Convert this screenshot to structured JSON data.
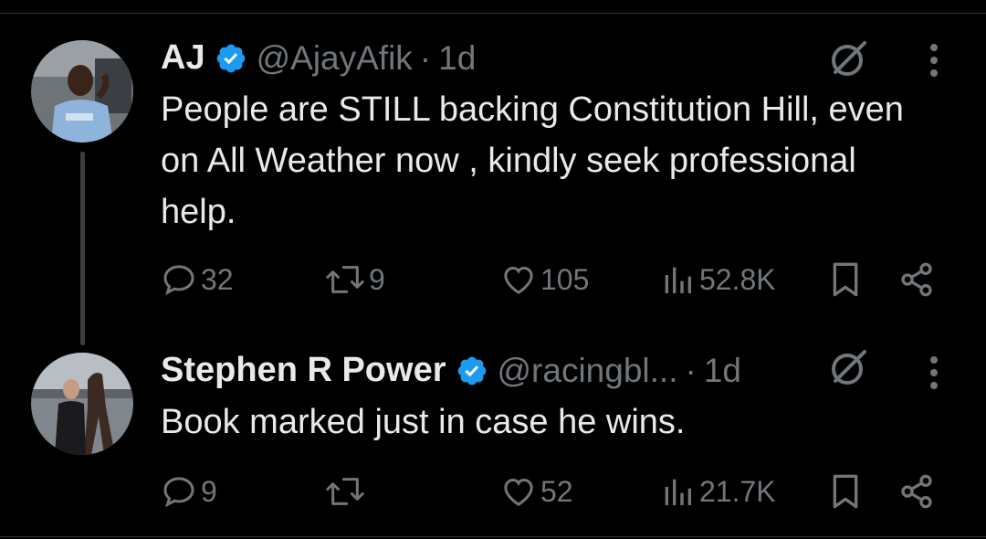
{
  "tweets": [
    {
      "name": "AJ",
      "handle": "@AjayAfik",
      "dot": "·",
      "time": "1d",
      "text": "People are STILL backing Constitution Hill, even on All Weather now , kindly seek professional help.",
      "replies": "32",
      "retweets": "9",
      "likes": "105",
      "views": "52.8K"
    },
    {
      "name": "Stephen R Power",
      "handle": "@racingbl...",
      "dot": "·",
      "time": "1d",
      "text": "Book marked just in case he wins.",
      "replies": "9",
      "retweets": "",
      "likes": "52",
      "views": "21.7K"
    }
  ],
  "colors": {
    "background": "#000000",
    "text": "#e7e9ea",
    "muted": "#71767b",
    "verified": "#1d9bf0"
  }
}
